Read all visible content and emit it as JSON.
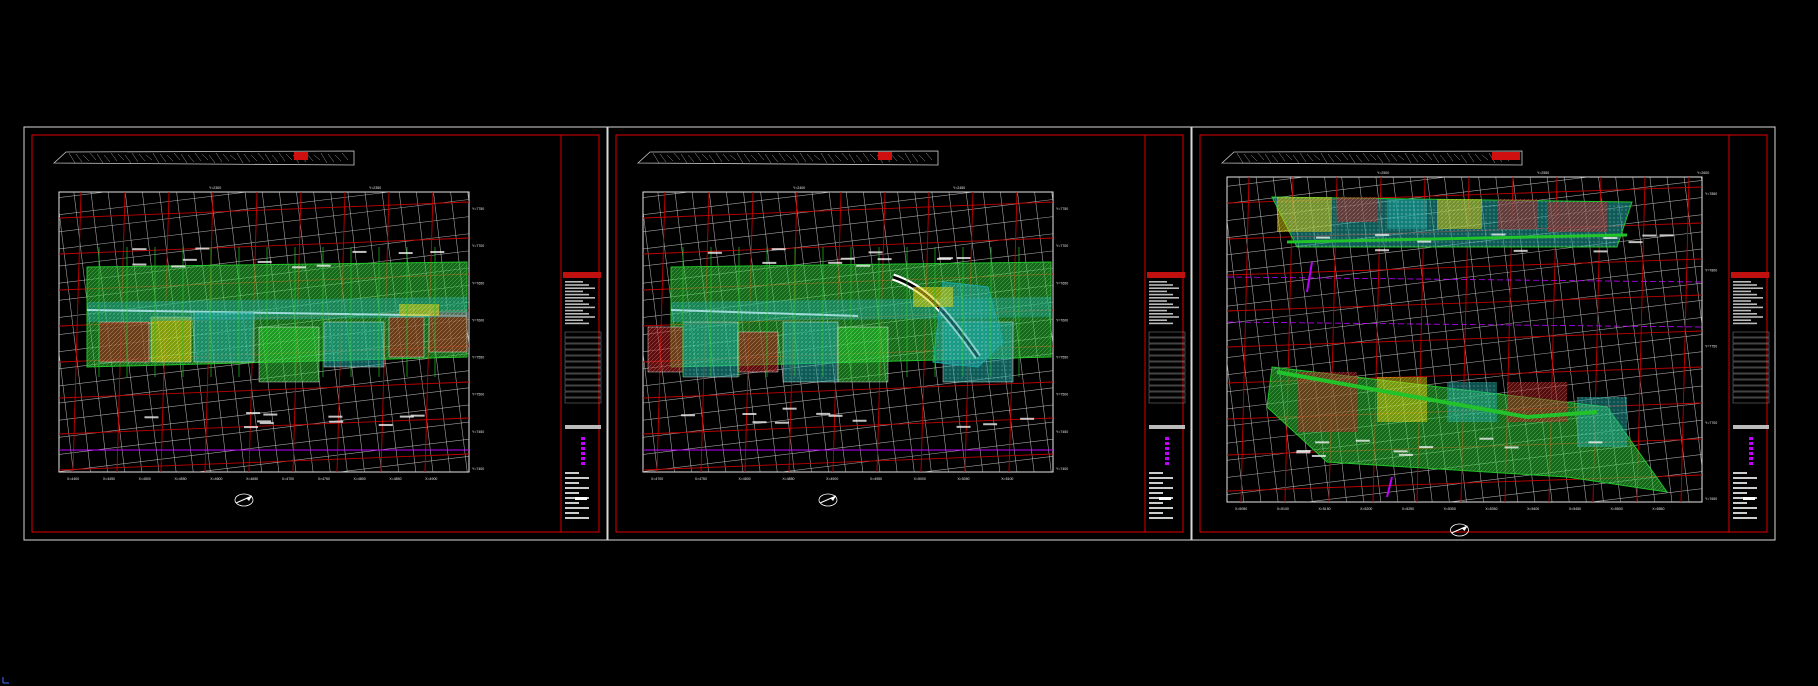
{
  "app": {
    "type": "CAD model space",
    "background": "#000000"
  },
  "colors": {
    "sheet_outer": "#d8d8d8",
    "sheet_inner": "#e00000",
    "grid_white": "#bfbfbf",
    "grid_red": "#c00000",
    "hatch_green": "#22c22a",
    "hatch_teal": "#1aa5a0",
    "hatch_red": "#b01818",
    "hatch_yellow": "#d8c800",
    "accent_magenta": "#c000ff",
    "callout_white": "#f0f0f0"
  },
  "sheets": [
    {
      "name": "sheet-1",
      "grid_labels": {
        "top": [
          "Y=2300",
          "Y=2350"
        ],
        "right": [
          "Y=7750",
          "Y=7700",
          "Y=7650",
          "Y=7600",
          "Y=7550",
          "Y=7500",
          "Y=7450",
          "Y=7400"
        ],
        "bottom": [
          "X=4400",
          "X=4450",
          "X=4500",
          "X=4550",
          "X=4600",
          "X=4650",
          "X=4700",
          "X=4750",
          "X=4800",
          "X=4850",
          "X=4900"
        ]
      },
      "plan_features": [
        "green-band",
        "teal-blocks",
        "red-blocks",
        "yellow-stripes"
      ]
    },
    {
      "name": "sheet-2",
      "grid_labels": {
        "top": [
          "Y=2400",
          "Y=2450"
        ],
        "right": [
          "Y=7750",
          "Y=7700",
          "Y=7650",
          "Y=7600",
          "Y=7550",
          "Y=7500",
          "Y=7450",
          "Y=7400"
        ],
        "bottom": [
          "X=4700",
          "X=4750",
          "X=4800",
          "X=4850",
          "X=4900",
          "X=4950",
          "X=5000",
          "X=5050",
          "X=5100"
        ]
      },
      "plan_features": [
        "green-band",
        "teal-blocks",
        "road-curve",
        "yellow-stripes"
      ]
    },
    {
      "name": "sheet-3",
      "grid_labels": {
        "top": [
          "Y=2500",
          "Y=2550",
          "Y=2600"
        ],
        "right": [
          "Y=7850",
          "Y=7800",
          "Y=7750",
          "Y=7700",
          "Y=7650"
        ],
        "bottom": [
          "X=5050",
          "X=5100",
          "X=5150",
          "X=5200",
          "X=5250",
          "X=5300",
          "X=5350",
          "X=5400",
          "X=5450",
          "X=5500",
          "X=5550"
        ]
      },
      "plan_features": [
        "upper-strip",
        "lower-parcel",
        "green-path"
      ]
    }
  ]
}
